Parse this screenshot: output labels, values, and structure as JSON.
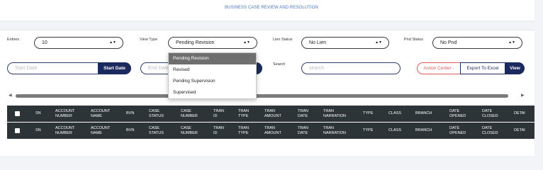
{
  "banner": "BUSINESS CASE REVIEW AND RESOLUTION",
  "filters": {
    "entries_label": "Entries",
    "entries_value": "10",
    "view_type_label": "View Type",
    "view_type_value": "Pending Revision",
    "lien_status_label": "Lien Status",
    "lien_status_value": "No Lien",
    "pnd_status_label": "Pnd Status",
    "pnd_status_value": "No Pnd",
    "start_date_placeholder": "Start Date",
    "start_date_button": "Start Date",
    "end_date_placeholder": "End Date",
    "search_label": "Search",
    "search_placeholder": "search",
    "action_center_label": "Action Center",
    "export_label": "Export To Excel",
    "view_label": "View"
  },
  "view_type_options": [
    "Pending Revision",
    "Revised",
    "Pending Supervision",
    "Supervised"
  ],
  "table": {
    "columns": [
      "SN",
      "ACCOUNT NUMBER",
      "ACCOUNT NAME",
      "BVN",
      "CASE STATUS",
      "CASE NUMBER",
      "TRAN ID",
      "TRAN TYPE",
      "TRAN AMOUNT",
      "TRAN DATE",
      "TRAN NARRATION",
      "TYPE",
      "CLASS",
      "BRANCH",
      "DATE OPENED",
      "DATE CLOSED",
      "DETAI"
    ]
  },
  "colors": {
    "navy": "#1b2a5e",
    "header_bg": "#2d3437",
    "banner_text": "#4a78b9",
    "action_red": "#e05a5a"
  },
  "icons": {
    "scroll_left": "triangle-left",
    "scroll_right": "triangle-right",
    "dropdown_caret": "updown-caret"
  }
}
